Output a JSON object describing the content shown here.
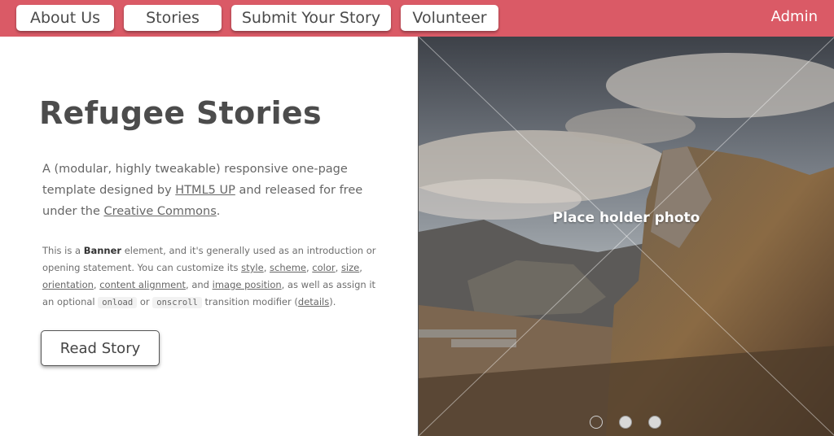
{
  "nav": {
    "items": [
      {
        "label": "About Us"
      },
      {
        "label": "Stories"
      },
      {
        "label": "Submit Your Story"
      },
      {
        "label": "Volunteer"
      }
    ],
    "admin_label": "Admin"
  },
  "banner": {
    "title": "Refugee Stories",
    "lead_before_link1": "A (modular, highly tweakable) responsive one-page template designed by ",
    "lead_link1": "HTML5 UP",
    "lead_between": " and released for free under the ",
    "lead_link2": "Creative Commons",
    "lead_end": ".",
    "small_1": "This is a ",
    "small_bold": "Banner",
    "small_2": " element, and it's generally used as an introduction or opening statement. You can customize its ",
    "link_style": "style",
    "link_scheme": "scheme",
    "link_color": "color",
    "link_size": "size",
    "link_orientation": "orientation",
    "link_alignment": "content alignment",
    "small_and": ", and ",
    "link_image_position": "image position",
    "small_3": ", as well as assign it an optional ",
    "code_onload": "onload",
    "small_or": " or ",
    "code_onscroll": "onscroll",
    "small_4": " transition modifier (",
    "link_details": "details",
    "small_end": ").",
    "button_label": "Read Story"
  },
  "photo": {
    "caption": "Place holder photo",
    "slides": 3,
    "active_slide": 1
  },
  "colors": {
    "accent": "#da5a66",
    "text": "#4c4c4c"
  }
}
